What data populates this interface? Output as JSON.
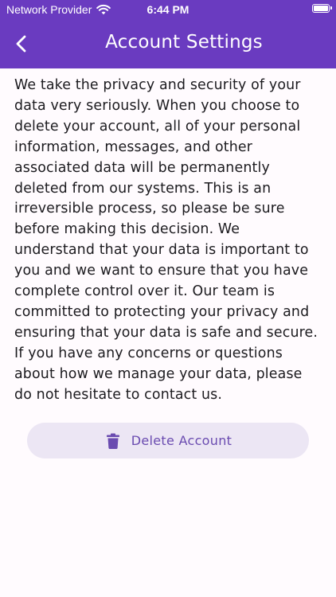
{
  "status_bar": {
    "carrier": "Network Provider",
    "time": "6:44 PM"
  },
  "app_bar": {
    "title": "Account Settings"
  },
  "body": {
    "text": "We take the privacy and security of your data very seriously. When you choose to delete your account, all of your personal information, messages, and other associated data will be permanently deleted from our systems. This is an irreversible process, so please be sure before making this decision. We understand that your data is important to you and we want to ensure that you have complete control over it. Our team is committed to protecting your privacy and ensuring that your data is safe and secure. If you have any concerns or questions about how we manage your data, please do not hesitate to contact us."
  },
  "delete_button": {
    "label": "Delete Account",
    "icon": "trash-icon"
  },
  "colors": {
    "primary": "#6a3bc0",
    "button_bg": "#ece6f4",
    "button_fg": "#6a4bb0",
    "text": "#1c1b1f",
    "background": "#fffbfe"
  }
}
